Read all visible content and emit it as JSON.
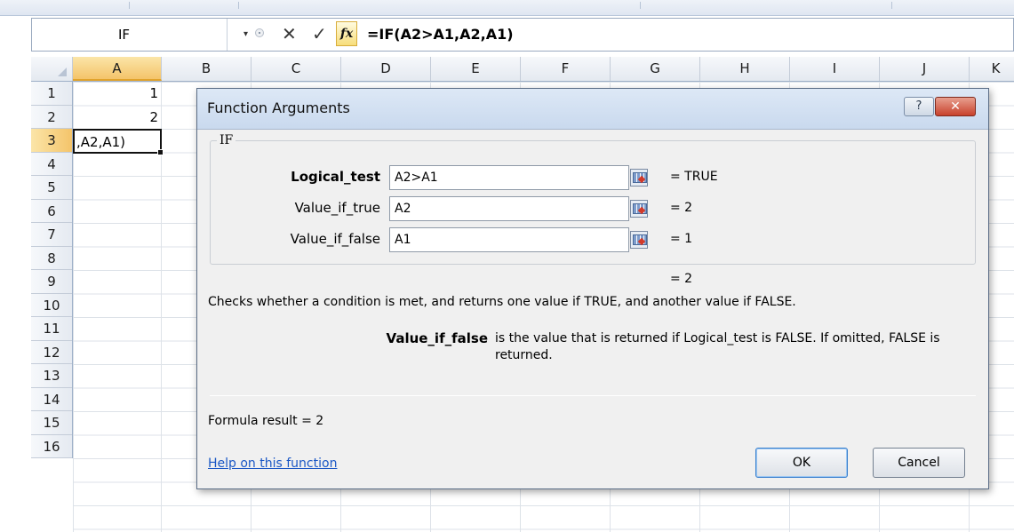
{
  "formula_bar": {
    "name_box": "IF",
    "dropdown_glyph": "▾",
    "cancel_glyph": "✕",
    "enter_glyph": "✓",
    "fx_label": "fx",
    "formula": "=IF(A2>A1,A2,A1)"
  },
  "sheet": {
    "columns": [
      "A",
      "B",
      "C",
      "D",
      "E",
      "F",
      "G",
      "H",
      "I",
      "J",
      "K"
    ],
    "active_column": "A",
    "rows": [
      "1",
      "2",
      "3",
      "4",
      "5",
      "6",
      "7",
      "8",
      "9",
      "10",
      "11",
      "12",
      "13",
      "14",
      "15",
      "16"
    ],
    "active_row": "3",
    "cells": {
      "A1": "1",
      "A2": "2",
      "A3": ",A2,A1)"
    }
  },
  "dialog": {
    "title": "Function Arguments",
    "help_glyph": "?",
    "close_glyph": "✕",
    "function_name": "IF",
    "arguments": [
      {
        "label": "Logical_test",
        "value": "A2>A1",
        "result": "=  TRUE"
      },
      {
        "label": "Value_if_true",
        "value": "A2",
        "result": "=  2"
      },
      {
        "label": "Value_if_false",
        "value": "A1",
        "result": "=  1"
      }
    ],
    "overall_result": "=  2",
    "description": "Checks whether a condition is met, and returns one value if TRUE, and another value if FALSE.",
    "arg_help_name": "Value_if_false",
    "arg_help_text": "is the value that is returned if Logical_test is FALSE. If omitted, FALSE is returned.",
    "formula_result": "Formula result =  2",
    "help_link": "Help on this function",
    "ok_label": "OK",
    "cancel_label": "Cancel"
  },
  "colors": {
    "active_header": "#f4c46a",
    "dialog_bg": "#f0f0f0",
    "close_button": "#c8412c",
    "link": "#1a57c5"
  }
}
